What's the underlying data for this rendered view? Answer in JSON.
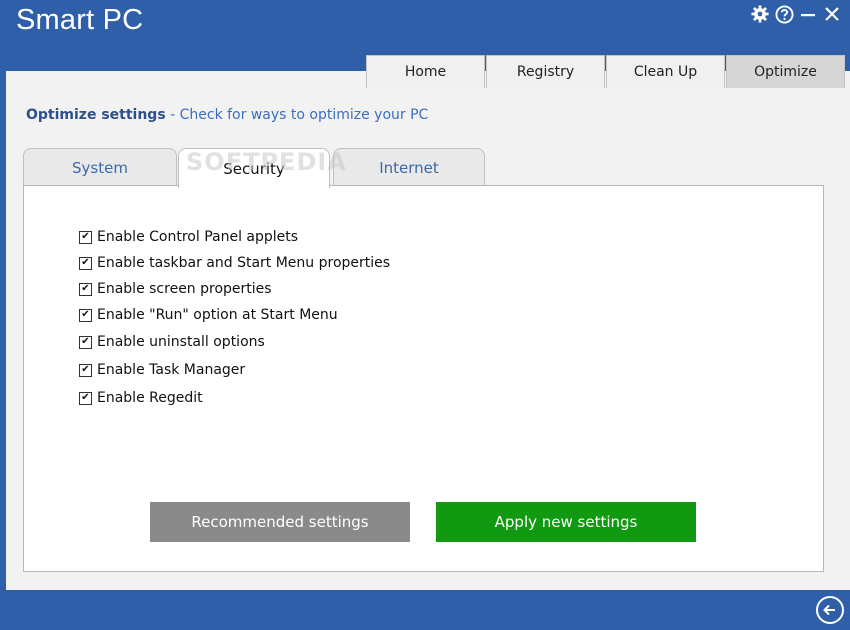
{
  "app": {
    "title": "Smart PC"
  },
  "window_controls": [
    "gear-icon",
    "help-icon",
    "minimize-icon",
    "close-icon"
  ],
  "nav": {
    "tabs": [
      "Home",
      "Registry",
      "Clean Up",
      "Optimize"
    ],
    "active": "Optimize"
  },
  "page": {
    "heading": "Optimize settings",
    "subheading": "- Check for ways to optimize your PC"
  },
  "subtabs": {
    "items": [
      "System",
      "Security",
      "Internet"
    ],
    "active": "Security"
  },
  "watermark": "SOFTPEDIA",
  "options": [
    {
      "label": "Enable Control Panel applets",
      "checked": true
    },
    {
      "label": "Enable taskbar and Start Menu properties",
      "checked": true
    },
    {
      "label": "Enable screen properties",
      "checked": true
    },
    {
      "label": "Enable \"Run\" option at Start Menu",
      "checked": true
    },
    {
      "label": "Enable uninstall options",
      "checked": true
    },
    {
      "label": "Enable Task Manager",
      "checked": true
    },
    {
      "label": "Enable Regedit",
      "checked": true
    }
  ],
  "buttons": {
    "recommended": "Recommended settings",
    "apply": "Apply new settings"
  },
  "colors": {
    "title_bar": "#2f5fa8",
    "heading": "#2d4f8a",
    "subheading": "#3a6fc0",
    "apply_button": "#119911",
    "recommended_button": "#8a8a8a"
  }
}
